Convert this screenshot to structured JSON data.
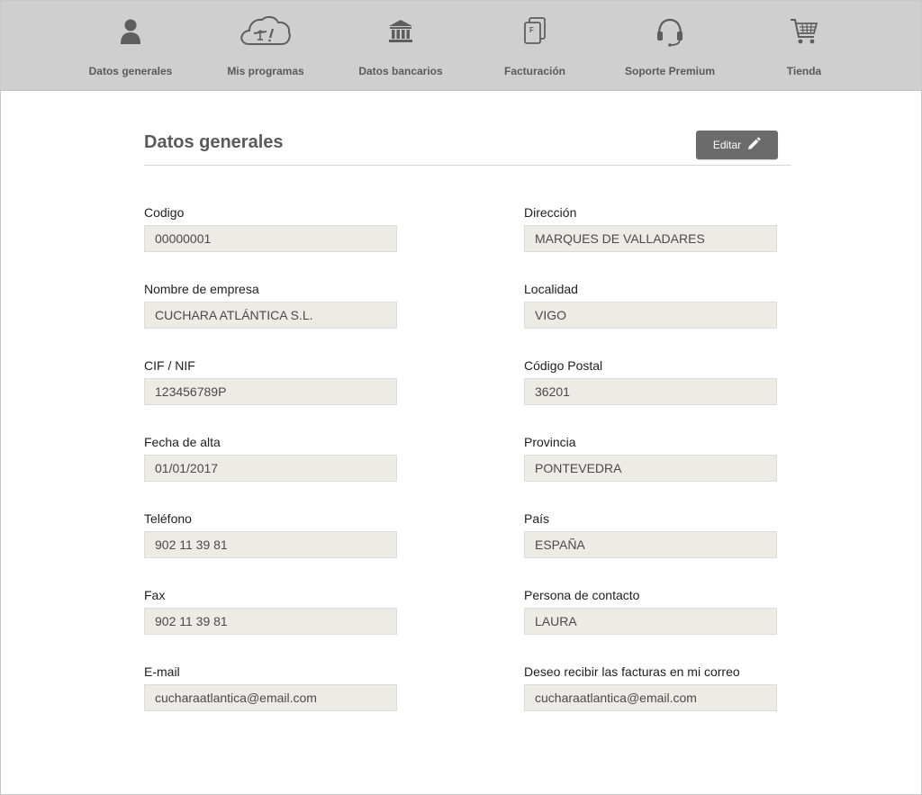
{
  "nav": {
    "items": [
      {
        "label": "Datos generales",
        "icon": "user-icon"
      },
      {
        "label": "Mis programas",
        "icon": "cloud-programs-icon"
      },
      {
        "label": "Datos bancarios",
        "icon": "bank-icon"
      },
      {
        "label": "Facturación",
        "icon": "invoice-icon"
      },
      {
        "label": "Soporte Premium",
        "icon": "headset-icon"
      },
      {
        "label": "Tienda",
        "icon": "cart-icon"
      }
    ]
  },
  "colors": {
    "nav_bg": "#d0cfcf",
    "field_bg": "#ecebe6",
    "button_bg": "#6b6b6b"
  },
  "page": {
    "title": "Datos generales",
    "edit_label": "Editar"
  },
  "fields": {
    "left": [
      {
        "label": "Codigo",
        "value": "00000001"
      },
      {
        "label": "Nombre de empresa",
        "value": "CUCHARA ATLÁNTICA S.L."
      },
      {
        "label": "CIF / NIF",
        "value": "123456789P"
      },
      {
        "label": "Fecha de alta",
        "value": "01/01/2017"
      },
      {
        "label": "Teléfono",
        "value": "902 11 39 81"
      },
      {
        "label": "Fax",
        "value": "902 11 39 81"
      },
      {
        "label": "E-mail",
        "value": "cucharaatlantica@email.com"
      }
    ],
    "right": [
      {
        "label": "Dirección",
        "value": "MARQUES DE VALLADARES"
      },
      {
        "label": "Localidad",
        "value": "VIGO"
      },
      {
        "label": "Código Postal",
        "value": "36201"
      },
      {
        "label": "Provincia",
        "value": "PONTEVEDRA"
      },
      {
        "label": "País",
        "value": "ESPAÑA"
      },
      {
        "label": "Persona de contacto",
        "value": "LAURA"
      },
      {
        "label": "Deseo recibir las facturas en mi correo",
        "value": "cucharaatlantica@email.com"
      }
    ]
  }
}
